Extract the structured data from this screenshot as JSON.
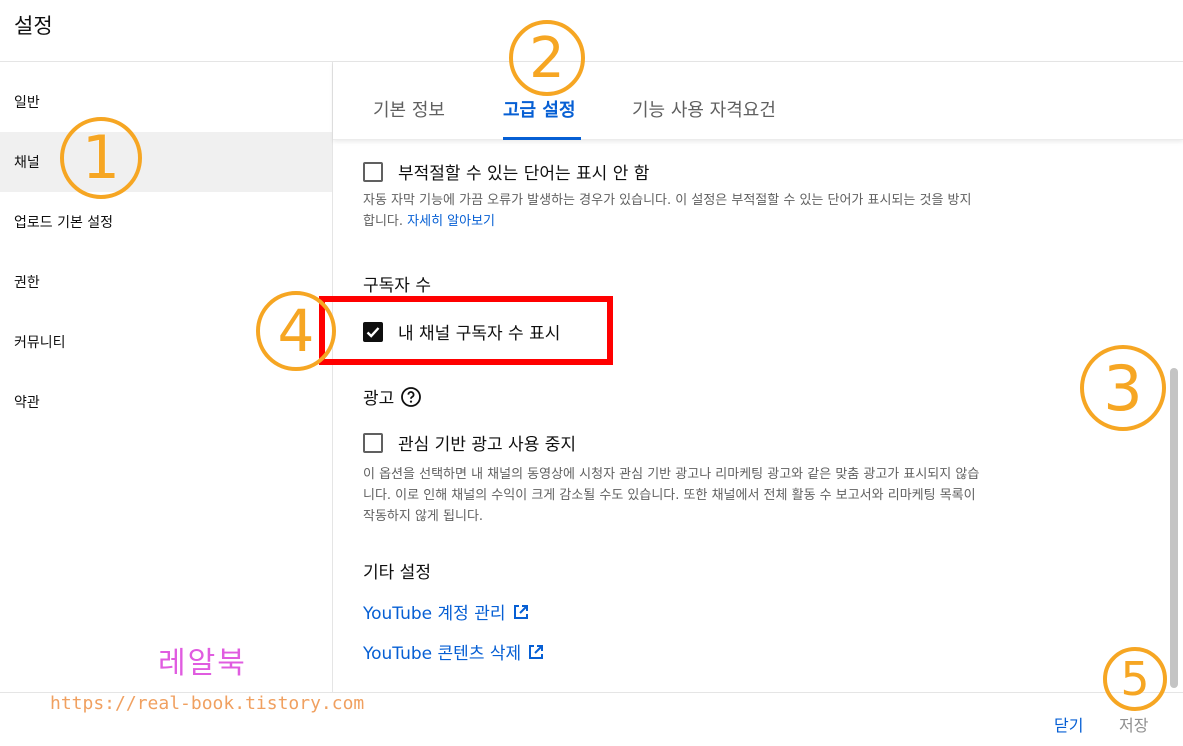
{
  "header": {
    "title": "설정"
  },
  "sidebar": {
    "items": [
      {
        "label": "일반"
      },
      {
        "label": "채널"
      },
      {
        "label": "업로드 기본 설정"
      },
      {
        "label": "권한"
      },
      {
        "label": "커뮤니티"
      },
      {
        "label": "약관"
      }
    ],
    "active_index": 1
  },
  "tabs": [
    {
      "label": "기본 정보"
    },
    {
      "label": "고급 설정"
    },
    {
      "label": "기능 사용 자격요건"
    }
  ],
  "active_tab": 1,
  "content": {
    "profanity": {
      "label": "부적절할 수 있는 단어는 표시 안 함",
      "checked": false,
      "description_line1": "자동 자막 기능에 가끔 오류가 발생하는 경우가 있습니다. 이 설정은 부적절할 수 있는 단어가 표시되는 것을 방지",
      "description_line2": "합니다.",
      "learn_more": "자세히 알아보기"
    },
    "subscribers": {
      "title": "구독자 수",
      "label": "내 채널 구독자 수 표시",
      "checked": true
    },
    "ads": {
      "title": "광고",
      "label": "관심 기반 광고 사용 중지",
      "checked": false,
      "description_line1": "이 옵션을 선택하면 내 채널의 동영상에 시청자 관심 기반 광고나 리마케팅 광고와 같은 맞춤 광고가 표시되지 않습",
      "description_line2": "니다. 이로 인해 채널의 수익이 크게 감소될 수도 있습니다. 또한 채널에서 전체 활동 수 보고서와 리마케팅 목록이",
      "description_line3": "작동하지 않게 됩니다."
    },
    "other": {
      "title": "기타 설정",
      "links": [
        {
          "label": "YouTube 계정 관리"
        },
        {
          "label": "YouTube 콘텐츠 삭제"
        }
      ]
    }
  },
  "footer": {
    "close_label": "닫기",
    "save_label": "저장"
  },
  "annotations": {
    "n1": "1",
    "n2": "2",
    "n3": "3",
    "n4": "4",
    "n5": "5"
  },
  "watermark": {
    "title": "레알북",
    "url": "https://real-book.tistory.com"
  },
  "colors": {
    "accent": "#065fd4",
    "highlight": "#ff0000",
    "badge": "#f6a623"
  }
}
